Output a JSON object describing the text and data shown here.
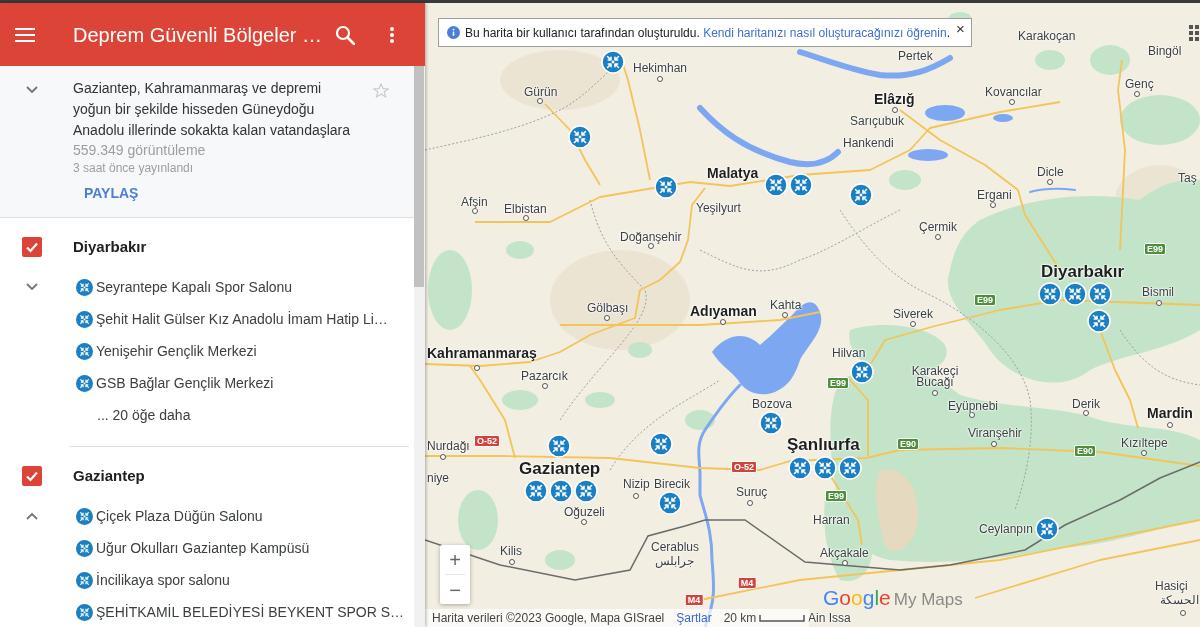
{
  "header": {
    "title": "Deprem Güvenli Bölgeler …"
  },
  "map_info": {
    "expanded": false,
    "description": "Gaziantep, Kahramanmaraş ve depremi yoğun bir şekilde hisseden Güneydoğu Anadolu illerinde sokakta kalan vatandaşlara",
    "starred": false,
    "views": "559.349 görüntüleme",
    "published": "3 saat önce yayınlandı",
    "share_label": "PAYLAŞ"
  },
  "layers": [
    {
      "name": "Diyarbakır",
      "checked": true,
      "expanded": false,
      "items": [
        "Seyrantepe Kapalı Spor Salonu",
        "Şehit Halit Gülser Kız Anadolu İmam Hatip Li…",
        "Yenişehir Gençlik Merkezi",
        "GSB Bağlar Gençlik Merkezi"
      ],
      "more_label": "... 20 öğe daha"
    },
    {
      "name": "Gaziantep",
      "checked": true,
      "expanded": true,
      "items": [
        "Çiçek Plaza Düğün Salonu",
        "Uğur Okulları Gaziantep Kampüsü",
        "İncilikaya spor salonu",
        "ŞEHİTKAMİL BELEDİYESİ BEYKENT SPOR S…"
      ]
    }
  ],
  "notice": {
    "text": "Bu harita bir kullanıcı tarafından oluşturuldu.",
    "link": "Kendi haritanızı nasıl oluşturacağınızı öğrenin",
    "end": ".",
    "close": "×"
  },
  "map": {
    "places": [
      {
        "name": "Karakoçan",
        "kind": "town"
      },
      {
        "name": "Pertek",
        "kind": "town"
      },
      {
        "name": "Bingöl",
        "kind": "town"
      },
      {
        "name": "Hekimhan",
        "kind": "town"
      },
      {
        "name": "Gürün",
        "kind": "town"
      },
      {
        "name": "Elâzığ",
        "kind": "city"
      },
      {
        "name": "Kovancılar",
        "kind": "town"
      },
      {
        "name": "Genç",
        "kind": "town"
      },
      {
        "name": "Sarıçubuk",
        "kind": "town"
      },
      {
        "name": "Hankendi",
        "kind": "town"
      },
      {
        "name": "Malatya",
        "kind": "city"
      },
      {
        "name": "Dicle",
        "kind": "town"
      },
      {
        "name": "Taş",
        "kind": "town"
      },
      {
        "name": "Afşin",
        "kind": "town"
      },
      {
        "name": "Elbistan",
        "kind": "town"
      },
      {
        "name": "Yeşilyurt",
        "kind": "town"
      },
      {
        "name": "Ergani",
        "kind": "town"
      },
      {
        "name": "Doğanşehir",
        "kind": "town"
      },
      {
        "name": "Çermik",
        "kind": "town"
      },
      {
        "name": "Diyarbakır",
        "kind": "metro"
      },
      {
        "name": "Bismil",
        "kind": "town"
      },
      {
        "name": "Gölbaşı",
        "kind": "town"
      },
      {
        "name": "Adıyaman",
        "kind": "city"
      },
      {
        "name": "Kahta",
        "kind": "town"
      },
      {
        "name": "Siverek",
        "kind": "town"
      },
      {
        "name": "Kahramanmaraş",
        "kind": "city"
      },
      {
        "name": "Hilvan",
        "kind": "town"
      },
      {
        "name": "Pazarcık",
        "kind": "town"
      },
      {
        "name": "Karakeçi Bucağı",
        "kind": "town"
      },
      {
        "name": "Bozova",
        "kind": "town"
      },
      {
        "name": "Eyüpnebi",
        "kind": "town"
      },
      {
        "name": "Derik",
        "kind": "town"
      },
      {
        "name": "Mardin",
        "kind": "city"
      },
      {
        "name": "Nurdağı",
        "kind": "town"
      },
      {
        "name": "Şanlıurfa",
        "kind": "metro"
      },
      {
        "name": "Viranşehir",
        "kind": "town"
      },
      {
        "name": "Kızıltepe",
        "kind": "town"
      },
      {
        "name": "Gaziantep",
        "kind": "metro"
      },
      {
        "name": "niye",
        "kind": "town"
      },
      {
        "name": "Nizip",
        "kind": "town"
      },
      {
        "name": "Birecik",
        "kind": "town"
      },
      {
        "name": "Suruç",
        "kind": "town"
      },
      {
        "name": "Oğuzeli",
        "kind": "town"
      },
      {
        "name": "Harran",
        "kind": "town"
      },
      {
        "name": "Ceylanpın",
        "kind": "town"
      },
      {
        "name": "Kilis",
        "kind": "town"
      },
      {
        "name": "Cerablus",
        "kind": "town"
      },
      {
        "name": "جرابلس",
        "kind": "town"
      },
      {
        "name": "Akçakale",
        "kind": "town"
      },
      {
        "name": "Hasiçi",
        "kind": "town"
      },
      {
        "name": "الحسكة",
        "kind": "town"
      },
      {
        "name": "Ain Issa",
        "kind": "town"
      }
    ],
    "road_signs": [
      {
        "label": "E99",
        "kind": "european"
      },
      {
        "label": "E99",
        "kind": "european"
      },
      {
        "label": "E99",
        "kind": "european"
      },
      {
        "label": "O-52",
        "kind": "national"
      },
      {
        "label": "E90",
        "kind": "european"
      },
      {
        "label": "E90",
        "kind": "european"
      },
      {
        "label": "O-52",
        "kind": "national"
      },
      {
        "label": "E99",
        "kind": "european"
      },
      {
        "label": "M4",
        "kind": "national"
      },
      {
        "label": "M4",
        "kind": "national"
      }
    ]
  },
  "zoom_controls": [
    "+",
    "−"
  ],
  "logo": {
    "brand": "Google",
    "product": "My Maps"
  },
  "attribution": {
    "data": "Harita verileri ©2023 Google, Mapa GISrael",
    "terms": "Şartlar",
    "scale": "20 km"
  }
}
